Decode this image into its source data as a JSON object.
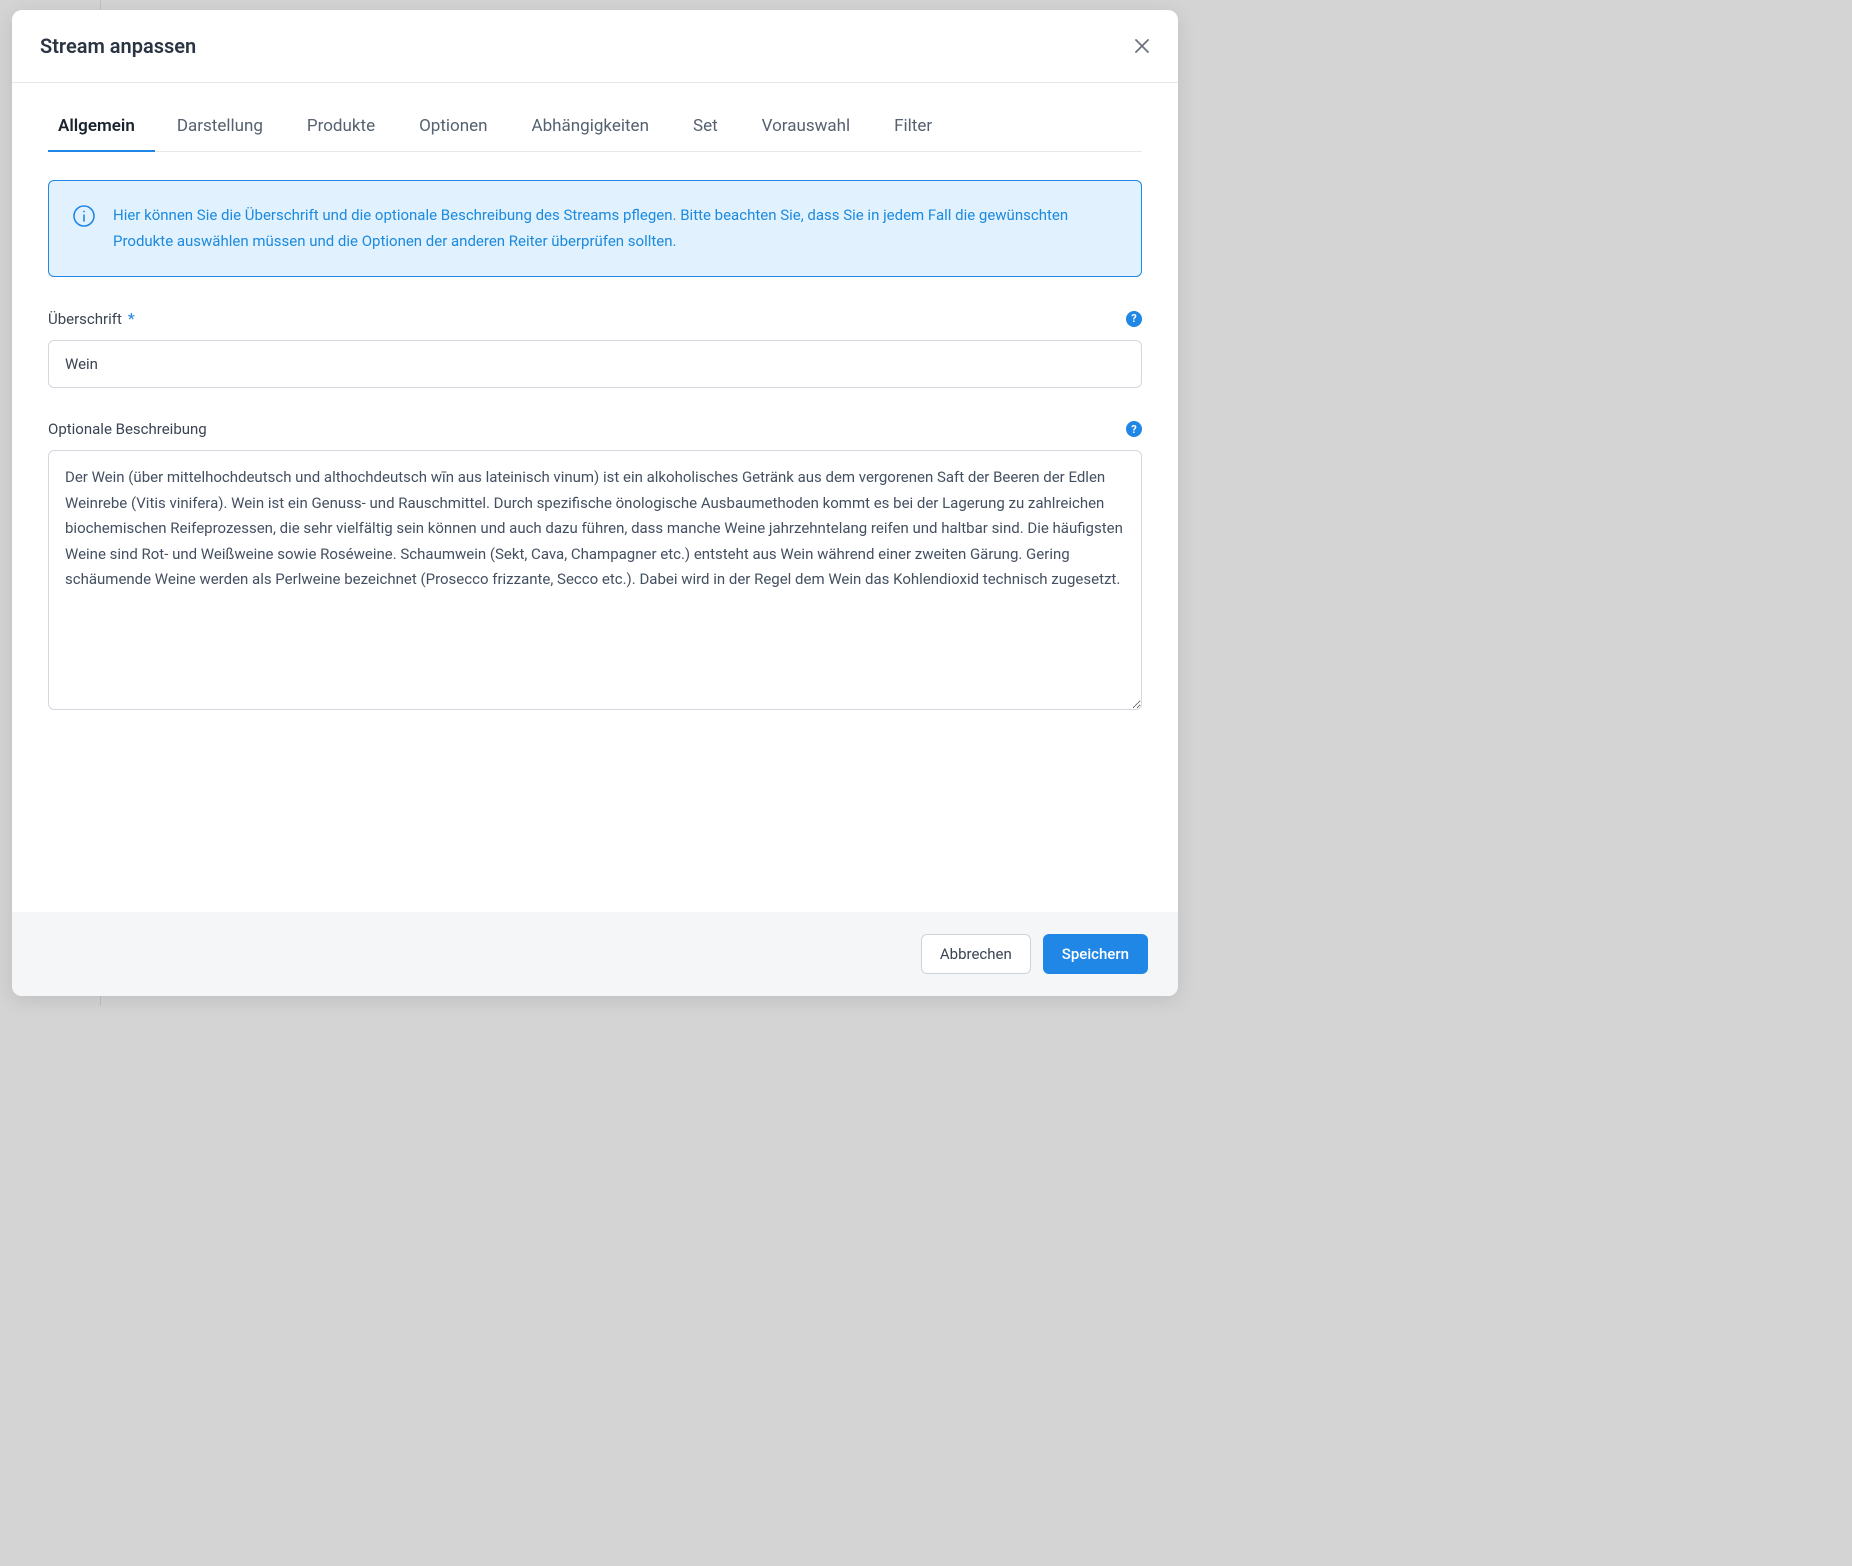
{
  "modal": {
    "title": "Stream anpassen",
    "tabs": [
      {
        "label": "Allgemein",
        "active": true
      },
      {
        "label": "Darstellung",
        "active": false
      },
      {
        "label": "Produkte",
        "active": false
      },
      {
        "label": "Optionen",
        "active": false
      },
      {
        "label": "Abhängigkeiten",
        "active": false
      },
      {
        "label": "Set",
        "active": false
      },
      {
        "label": "Vorauswahl",
        "active": false
      },
      {
        "label": "Filter",
        "active": false
      }
    ],
    "info_text": "Hier können Sie die Überschrift und die optionale Beschreibung des Streams pflegen. Bitte beachten Sie, dass Sie in jedem Fall die gewünschten Produkte auswählen müssen und die Optionen der anderen Reiter überprüfen sollten.",
    "fields": {
      "heading": {
        "label": "Überschrift",
        "required_marker": "*",
        "value": "Wein",
        "help": "?"
      },
      "description": {
        "label": "Optionale Beschreibung",
        "value": "Der Wein (über mittelhochdeutsch und althochdeutsch wīn aus lateinisch vinum) ist ein alkoholisches Getränk aus dem vergorenen Saft der Beeren der Edlen Weinrebe (Vitis vinifera). Wein ist ein Genuss- und Rauschmittel. Durch spezifische önologische Ausbaumethoden kommt es bei der Lagerung zu zahlreichen biochemischen Reifeprozessen, die sehr vielfältig sein können und auch dazu führen, dass manche Weine jahrzehntelang reifen und haltbar sind. Die häufigsten Weine sind Rot- und Weißweine sowie Roséweine. Schaumwein (Sekt, Cava, Champagner etc.) entsteht aus Wein während einer zweiten Gärung. Gering schäumende Weine werden als Perlweine bezeichnet (Prosecco frizzante, Secco etc.). Dabei wird in der Regel dem Wein das Kohlendioxid technisch zugesetzt.",
        "help": "?"
      }
    },
    "footer": {
      "cancel": "Abbrechen",
      "save": "Speichern"
    }
  }
}
